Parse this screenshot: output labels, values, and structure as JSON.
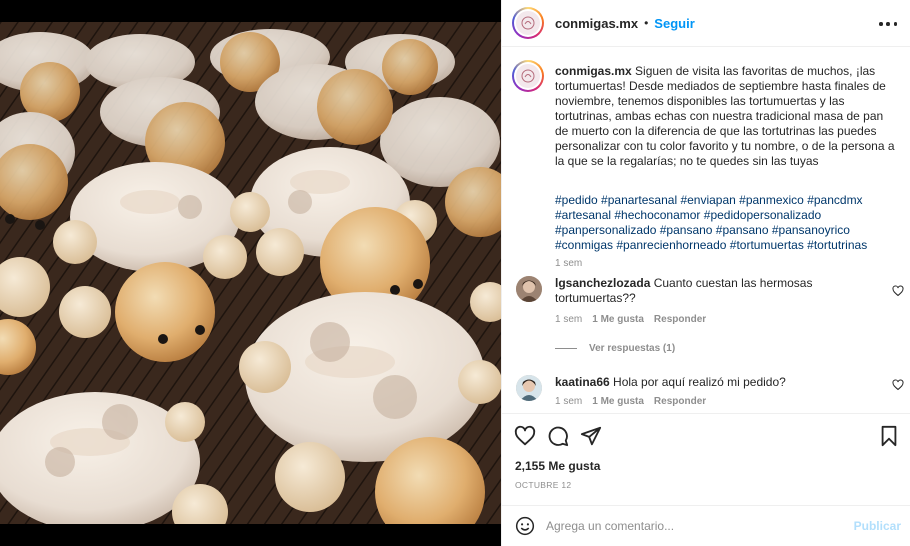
{
  "post": {
    "username": "conmigas.mx",
    "dot": "•",
    "follow_label": "Seguir"
  },
  "caption": {
    "username": "conmigas.mx",
    "text": "Siguen de visita las favoritas de muchos, ¡las tortumuertas! Desde mediados de septiembre hasta finales de noviembre, tenemos disponibles las tortumuertas y las tortutrinas, ambas echas con nuestra tradicional masa de pan de muerto con la diferencia de que las tortutrinas las puedes personalizar con tu color favorito y tu nombre, o de la persona a la que se la regalarías; no te quedes sin las tuyas",
    "hashtags": "#pedido #panartesanal #enviapan #panmexico #pancdmx #artesanal #hechoconamor #pedidopersonalizado #panpersonalizado #pansano #pansano #pansanoyrico #conmigas #panrecienhorneado #tortumuertas #tortutrinas",
    "time": "1 sem"
  },
  "comments": [
    {
      "username": "lgsanchezlozada",
      "text": "Cuanto cuestan las hermosas tortumuertas??",
      "time": "1 sem",
      "likes": "1 Me gusta",
      "reply_label": "Responder",
      "view_replies": "Ver respuestas (1)"
    },
    {
      "username": "kaatina66",
      "text": "Hola por aquí realizó mi pedido?",
      "time": "1 sem",
      "likes": "1 Me gusta",
      "reply_label": "Responder"
    }
  ],
  "actions": {
    "likes_count": "2,155 Me gusta",
    "date": "OCTUBRE 12"
  },
  "comment_box": {
    "placeholder": "Agrega un comentario...",
    "publish_label": "Publicar"
  },
  "icons": {
    "more": "more-options-icon",
    "like": "heart-icon",
    "comment": "comment-bubble-icon",
    "share": "paper-plane-icon",
    "save": "bookmark-icon",
    "emoji": "emoji-smiley-icon"
  },
  "colors": {
    "follow": "#0095f6",
    "hashtag": "#00376b",
    "muted": "#8e8e8e",
    "publish_disabled": "#b2dffc"
  }
}
